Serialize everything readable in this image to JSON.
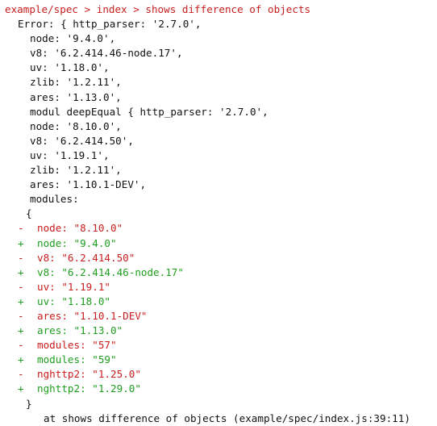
{
  "title": "example/spec > index > shows difference of objects",
  "error_lines": [
    "Error: { http_parser: '2.7.0',",
    "node: '9.4.0',",
    "v8: '6.2.414.46-node.17',",
    "uv: '1.18.0',",
    "zlib: '1.2.11',",
    "ares: '1.13.0',",
    "modul deepEqual { http_parser: '2.7.0',",
    "node: '8.10.0',",
    "v8: '6.2.414.50',",
    "uv: '1.19.1',",
    "zlib: '1.2.11',",
    "ares: '1.10.1-DEV',",
    "modules:"
  ],
  "open_brace": "{",
  "diff": [
    {
      "sign": "-",
      "text": "node: \"8.10.0\"",
      "kind": "removed"
    },
    {
      "sign": "+",
      "text": "node: \"9.4.0\"",
      "kind": "added"
    },
    {
      "sign": "-",
      "text": "v8: \"6.2.414.50\"",
      "kind": "removed"
    },
    {
      "sign": "+",
      "text": "v8: \"6.2.414.46-node.17\"",
      "kind": "added"
    },
    {
      "sign": "-",
      "text": "uv: \"1.19.1\"",
      "kind": "removed"
    },
    {
      "sign": "+",
      "text": "uv: \"1.18.0\"",
      "kind": "added"
    },
    {
      "sign": "-",
      "text": "ares: \"1.10.1-DEV\"",
      "kind": "removed"
    },
    {
      "sign": "+",
      "text": "ares: \"1.13.0\"",
      "kind": "added"
    },
    {
      "sign": "-",
      "text": "modules: \"57\"",
      "kind": "removed"
    },
    {
      "sign": "+",
      "text": "modules: \"59\"",
      "kind": "added"
    },
    {
      "sign": "-",
      "text": "nghttp2: \"1.25.0\"",
      "kind": "removed"
    },
    {
      "sign": "+",
      "text": "nghttp2: \"1.29.0\"",
      "kind": "added"
    }
  ],
  "close_brace": "}",
  "stack": "at shows difference of objects (example/spec/index.js:39:11)",
  "colors": {
    "removed": "#c81e1e",
    "added": "#1f9e1f",
    "title": "#c81e1e",
    "text": "#111111",
    "background": "#ffffff"
  }
}
